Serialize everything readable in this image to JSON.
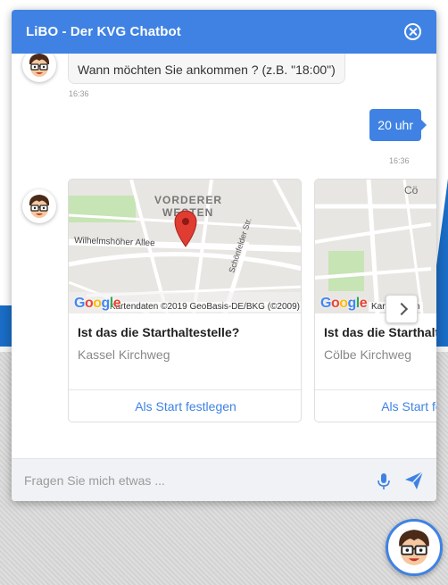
{
  "chat": {
    "title": "LiBO - Der KVG Chatbot",
    "input_placeholder": "Fragen Sie mich etwas ..."
  },
  "messages": [
    {
      "from": "bot",
      "text": "Wann möchten Sie ankommen ? (z.B. \"18:00\")",
      "time": "16:36"
    },
    {
      "from": "user",
      "text": "20 uhr",
      "time": "16:36"
    }
  ],
  "cards": [
    {
      "title": "Ist das die Starthaltestelle?",
      "subtitle": "Kassel Kirchweg",
      "button": "Als Start festlegen",
      "map": {
        "labels": [
          "VORDERER",
          "WESTEN",
          "Wilhelmshöher Allee",
          "Schönfelder Str."
        ],
        "copyright": "Kartendaten ©2019 GeoBasis-DE/BKG (©2009)",
        "logo": "Google"
      }
    },
    {
      "title": "Ist das die Starthaltestelle?",
      "subtitle": "Cölbe Kirchweg",
      "button": "Als Start festlegen",
      "map": {
        "labels": [
          "Cö"
        ],
        "copyright": "Kartendaten",
        "logo": "Google"
      }
    }
  ],
  "colors": {
    "header": "#3f82e4",
    "accent_blue": "#1a6cc4",
    "link": "#3f82e4"
  },
  "icons": [
    "close-icon",
    "chevron-right-icon",
    "microphone-icon",
    "send-icon",
    "bot-avatar-icon",
    "map-pin-icon"
  ]
}
